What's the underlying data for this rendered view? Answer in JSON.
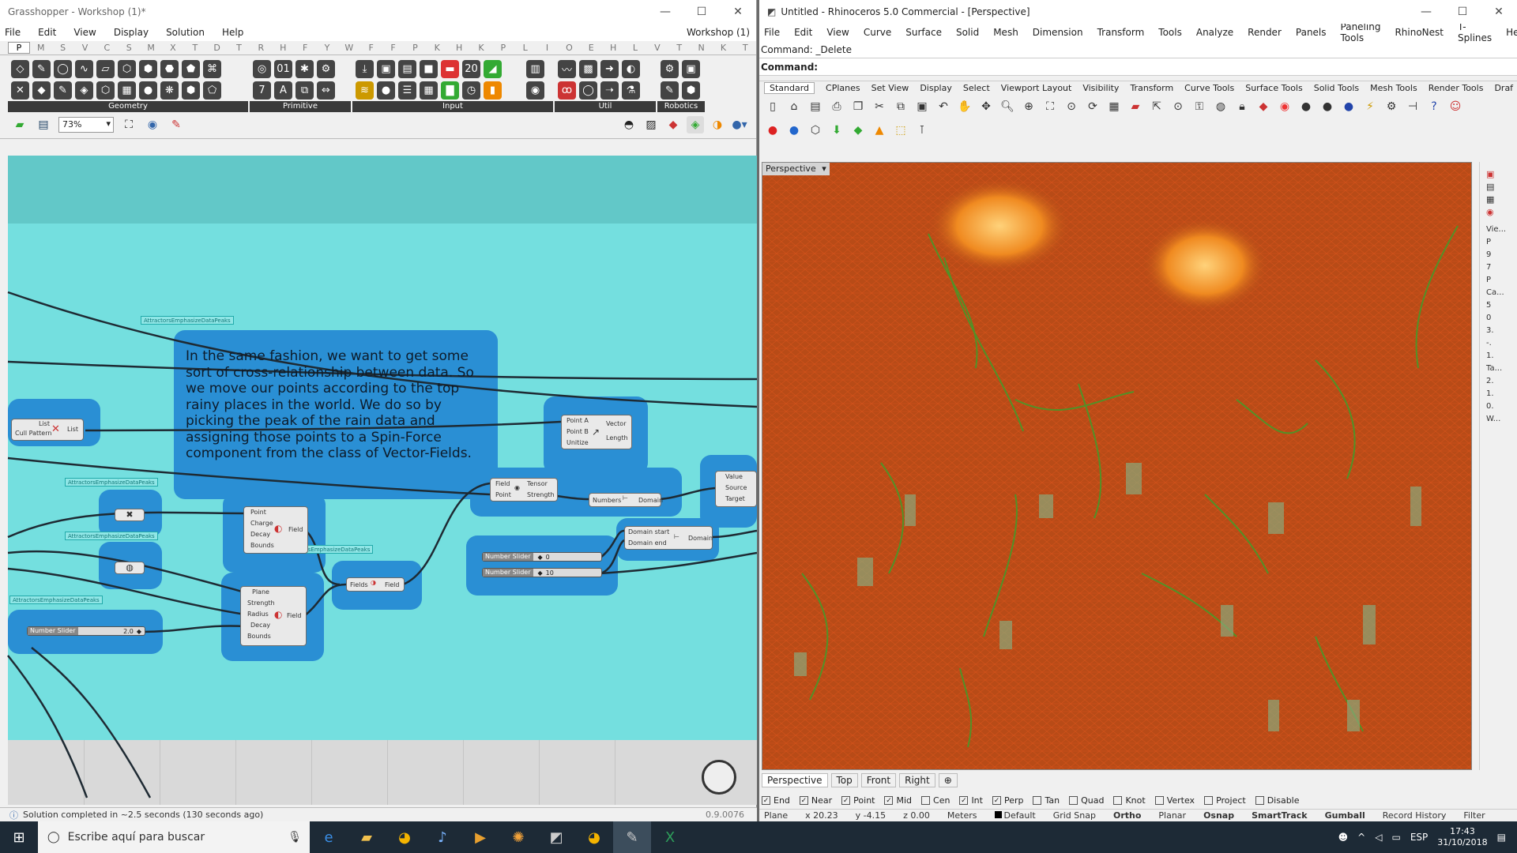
{
  "grasshopper": {
    "title": "Grasshopper - Workshop (1)*",
    "menu": [
      "File",
      "Edit",
      "View",
      "Display",
      "Solution",
      "Help"
    ],
    "doc_name": "Workshop (1)",
    "tabs": [
      "P",
      "M",
      "S",
      "V",
      "C",
      "S",
      "M",
      "X",
      "T",
      "D",
      "T",
      "R",
      "H",
      "F",
      "Y",
      "W",
      "F",
      "F",
      "P",
      "K",
      "H",
      "K",
      "P",
      "L",
      "I",
      "O",
      "E",
      "H",
      "L",
      "V",
      "T",
      "N",
      "K",
      "T"
    ],
    "ribbon_groups": [
      "Geometry",
      "Primitive",
      "Input",
      "Util",
      "Robotics"
    ],
    "zoom": "73%",
    "note": "In the same fashion, we want to get some sort of cross-relationship between data. So we move our points according to the top rainy places in the world. We do so by picking the peak of the rain data and assigning those points to a Spin-Force component from the class of Vector-Fields.",
    "tags": {
      "t1": "AttractorsEmphasizeDataPeaks",
      "t2": "AttractorsEmphasizeDataPeaks",
      "t3": "AttractorsEmphasizeDataPeaks",
      "t4": "AttractorsEmphasizeDataPeaks",
      "t5": "ctorsEmphasizeDataPeaks"
    },
    "components": {
      "cull": {
        "in1": "List",
        "in2": "Cull Pattern",
        "out": "List"
      },
      "vec": {
        "in1": "Point A",
        "in2": "Point B",
        "in3": "Unitize",
        "out1": "Vector",
        "out2": "Length"
      },
      "tensor": {
        "in1": "Field",
        "in2": "Point",
        "out1": "Tensor",
        "out2": "Strength"
      },
      "bounds": {
        "in": "Numbers",
        "out": "Domain"
      },
      "vpart": {
        "in1": "Value",
        "in2": "Source",
        "in3": "Target"
      },
      "pcharge": {
        "in1": "Point",
        "in2": "Charge",
        "in3": "Decay",
        "in4": "Bounds",
        "out": "Field"
      },
      "spin": {
        "in1": "Plane",
        "in2": "Strength",
        "in3": "Radius",
        "in4": "Decay",
        "in5": "Bounds",
        "out": "Field"
      },
      "merge": {
        "in": "Fields",
        "out": "Field"
      },
      "domain": {
        "in1": "Domain start",
        "in2": "Domain end",
        "out": "Domain"
      }
    },
    "sliders": {
      "s1": {
        "label": "Number Slider",
        "value": "0"
      },
      "s2": {
        "label": "Number Slider",
        "value": "10"
      },
      "s3": {
        "label": "Number Slider",
        "value": "2.0"
      }
    },
    "status": "Solution completed in ~2.5 seconds (130 seconds ago)",
    "version": "0.9.0076"
  },
  "rhino": {
    "title": "Untitled - Rhinoceros 5.0 Commercial - [Perspective]",
    "menu": [
      "File",
      "Edit",
      "View",
      "Curve",
      "Surface",
      "Solid",
      "Mesh",
      "Dimension",
      "Transform",
      "Tools",
      "Analyze",
      "Render",
      "Panels",
      "Paneling Tools",
      "RhinoNest",
      "T-Splines",
      "Help"
    ],
    "command_history": "Command: _Delete",
    "command_prompt": "Command:",
    "toolbar_tabs": [
      "Standard",
      "CPlanes",
      "Set View",
      "Display",
      "Select",
      "Viewport Layout",
      "Visibility",
      "Transform",
      "Curve Tools",
      "Surface Tools",
      "Solid Tools",
      "Mesh Tools",
      "Render Tools",
      "Draf"
    ],
    "viewport_label": "Perspective",
    "viewport_tabs": [
      "Perspective",
      "Top",
      "Front",
      "Right"
    ],
    "osnaps": [
      {
        "label": "End",
        "on": true
      },
      {
        "label": "Near",
        "on": true
      },
      {
        "label": "Point",
        "on": true
      },
      {
        "label": "Mid",
        "on": true
      },
      {
        "label": "Cen",
        "on": false
      },
      {
        "label": "Int",
        "on": true
      },
      {
        "label": "Perp",
        "on": true
      },
      {
        "label": "Tan",
        "on": false
      },
      {
        "label": "Quad",
        "on": false
      },
      {
        "label": "Knot",
        "on": false
      },
      {
        "label": "Vertex",
        "on": false
      },
      {
        "label": "Project",
        "on": false
      },
      {
        "label": "Disable",
        "on": false
      }
    ],
    "side_panel": [
      "Vie...",
      "P",
      "9",
      "7",
      "P",
      "Ca...",
      "5",
      "0",
      "3.",
      "-.",
      "1.",
      "Ta...",
      "2.",
      "1.",
      "0.",
      "W..."
    ],
    "statusbar": {
      "plane": "Plane",
      "x": "x 20.23",
      "y": "y -4.15",
      "z": "z 0.00",
      "units": "Meters",
      "layer": "Default",
      "grid_snap": "Grid Snap",
      "ortho": "Ortho",
      "planar": "Planar",
      "osnap": "Osnap",
      "smarttrack": "SmartTrack",
      "gumball": "Gumball",
      "record": "Record History",
      "filter": "Filter"
    }
  },
  "taskbar": {
    "search_placeholder": "Escribe aquí para buscar",
    "lang": "ESP",
    "time": "17:43",
    "date": "31/10/2018"
  },
  "colors": {
    "canvas": "#74dfdf",
    "group": "#2a8fd4",
    "viewport": "#b54a17",
    "mesh_green": "#3f9e2a"
  }
}
